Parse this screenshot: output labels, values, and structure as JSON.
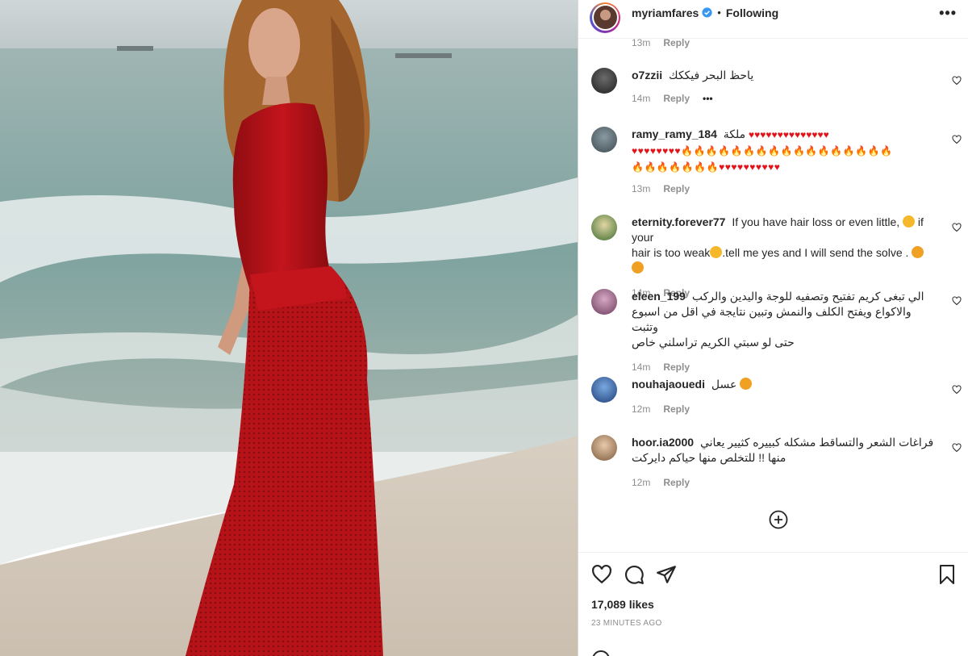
{
  "post": {
    "username": "myriamfares",
    "separator": "•",
    "follow_status": "Following",
    "more_label": "•••"
  },
  "top_reply": {
    "time": "13m",
    "reply": "Reply"
  },
  "comments": [
    {
      "user": "o7zzii",
      "text": "ياحظ البحر فيككك",
      "time": "14m",
      "reply": "Reply",
      "extra": "•••"
    },
    {
      "user": "ramy_ramy_184",
      "text": "ملكة",
      "hearts_line1": "♥♥♥♥♥♥♥♥♥♥♥♥♥♥",
      "line2": "♥♥♥♥♥♥♥♥🔥🔥🔥🔥🔥🔥🔥🔥🔥🔥🔥🔥🔥🔥🔥🔥🔥",
      "line3": "🔥🔥🔥🔥🔥🔥🔥♥♥♥♥♥♥♥♥♥♥",
      "time": "13m",
      "reply": "Reply"
    },
    {
      "user": "eternity.forever77",
      "text_a": "If you have hair loss or even little,",
      "text_b": "if your",
      "text_c": "hair is too weak",
      "text_d": ".tell me yes and I will send the solve .",
      "time": "14m",
      "reply": "Reply"
    },
    {
      "user": "eleen_199",
      "text": "الي تبغى كريم تفتيح وتصفيه للوجة واليدين والركب",
      "line2": "والاكواع ويفتح الكلف والنمش وتبين نتايجة في اقل من اسبوع وتثبت",
      "line3": "حتى لو سبتي الكريم تراسلني خاص",
      "time": "14m",
      "reply": "Reply"
    },
    {
      "user": "nouhajaouedi",
      "text": "عسل",
      "time": "12m",
      "reply": "Reply"
    },
    {
      "user": "hoor.ia2000",
      "text": "فراغات الشعر والتساقط مشكله كبييره كثيير يعاني",
      "line2": "منها !! للتخلص منها حياكم دايركت",
      "time": "12m",
      "reply": "Reply"
    }
  ],
  "footer": {
    "likes": "17,089 likes",
    "time_ago": "23 MINUTES AGO"
  },
  "colors": {
    "verified_blue": "#3897f0",
    "heart_red": "#e3151a",
    "dress_red": "#c4141c"
  },
  "icons": [
    "heart-icon",
    "comment-icon",
    "share-icon",
    "bookmark-icon",
    "add-comments-icon",
    "more-icon",
    "verified-icon"
  ]
}
